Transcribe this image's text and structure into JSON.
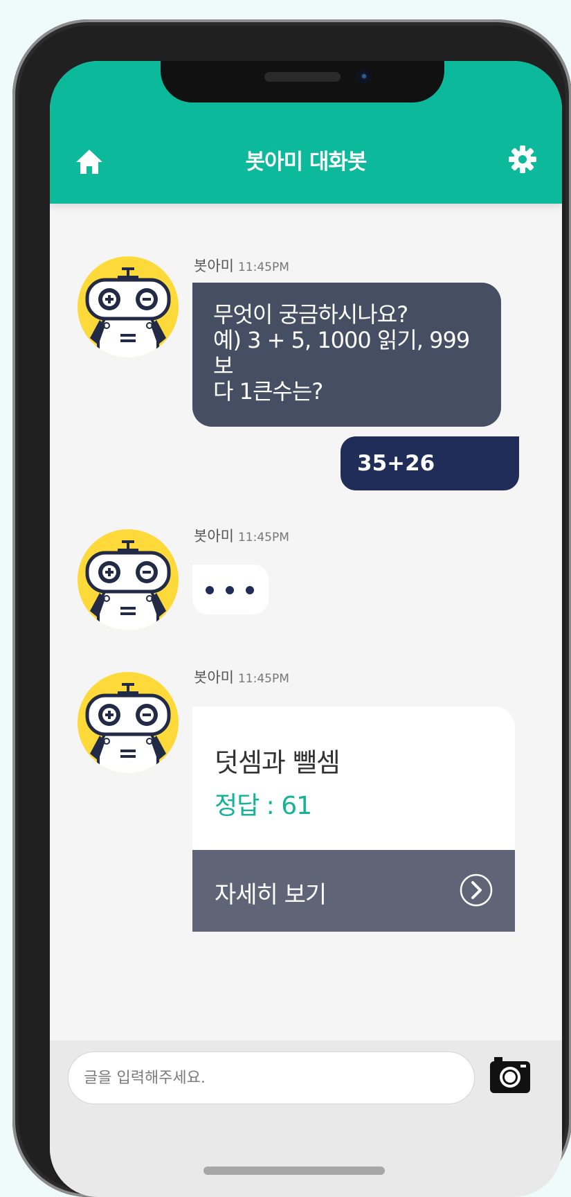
{
  "header": {
    "title": "봇아미 대화봇",
    "home_icon": "home-icon",
    "settings_icon": "gear-icon",
    "color": "#0cb99a"
  },
  "messages": [
    {
      "sender": "봇아미",
      "time": "11:45PM",
      "text_lines": [
        "무엇이 궁금하시나요?",
        "예) 3 + 5, 1000 읽기, 999보",
        "다 1큰수는?"
      ]
    },
    {
      "sender": "user",
      "text": "35+26"
    },
    {
      "sender": "봇아미",
      "time": "11:45PM",
      "typing": true
    },
    {
      "sender": "봇아미",
      "time": "11:45PM",
      "card": {
        "title": "덧셈과 뺄셈",
        "answer": "정답 : 61",
        "action_label": "자세히 보기",
        "action_icon": "chevron-right-circle-icon"
      }
    }
  ],
  "input": {
    "placeholder": "글을 입력해주세요.",
    "value": "",
    "camera_icon": "camera-icon"
  },
  "colors": {
    "bot_bubble": "#464e64",
    "user_bubble": "#1f2d58",
    "answer_text": "#12b396",
    "card_footer": "#5f6577"
  }
}
